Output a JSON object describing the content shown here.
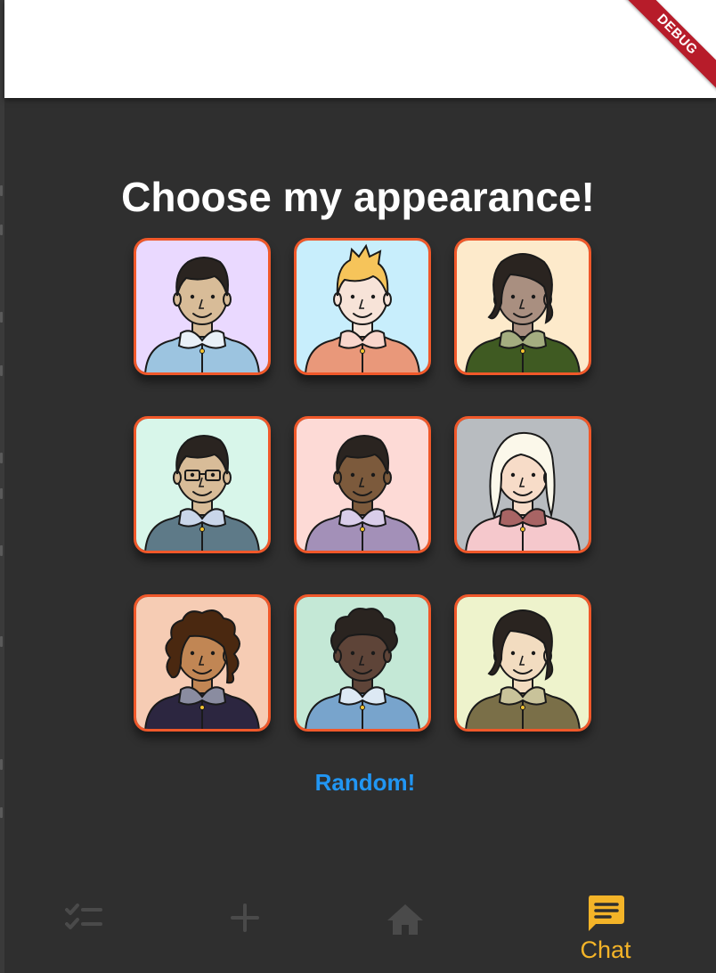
{
  "debug_banner": "DEBUG",
  "title": "Choose my appearance!",
  "random_label": "Random!",
  "avatars": [
    {
      "bg": "#ead9ff",
      "skin": "#d8bc98",
      "hair": "#2a2420",
      "shirt": "#9cc4e0",
      "collar": "#e9f0f7",
      "hair_style": "short"
    },
    {
      "bg": "#c8eefc",
      "skin": "#f7e3d8",
      "hair": "#f6c45a",
      "shirt": "#e9987a",
      "collar": "#f9d6cc",
      "hair_style": "spiky"
    },
    {
      "bg": "#fdeacb",
      "skin": "#a98f80",
      "hair": "#2a2420",
      "shirt": "#3f5a22",
      "collar": "#a4ad80",
      "hair_style": "bob"
    },
    {
      "bg": "#d8f6ea",
      "skin": "#d8bc98",
      "hair": "#2a2420",
      "shirt": "#5e7a88",
      "collar": "#c9d6ea",
      "hair_style": "short",
      "glasses": true
    },
    {
      "bg": "#fddad6",
      "skin": "#7c5a3c",
      "hair": "#2a2420",
      "shirt": "#a390b8",
      "collar": "#d9cdea",
      "hair_style": "short"
    },
    {
      "bg": "#b8bcc0",
      "skin": "#f7dcc8",
      "hair": "#fbf8ea",
      "shirt": "#f5c8cc",
      "collar": "#a86464",
      "hair_style": "long"
    },
    {
      "bg": "#f6ccb4",
      "skin": "#c18654",
      "hair": "#4a2810",
      "shirt": "#2c2640",
      "collar": "#8a8ca0",
      "hair_style": "curly"
    },
    {
      "bg": "#c4e8d6",
      "skin": "#5e4438",
      "hair": "#2a2420",
      "shirt": "#78a4cc",
      "collar": "#dde9f4",
      "hair_style": "afro"
    },
    {
      "bg": "#eef3cc",
      "skin": "#f2dcc0",
      "hair": "#2a2420",
      "shirt": "#7a6f48",
      "collar": "#c9c39a",
      "hair_style": "bob"
    }
  ],
  "nav": {
    "items": [
      {
        "icon": "checklist-icon",
        "label": ""
      },
      {
        "icon": "add-icon",
        "label": ""
      },
      {
        "icon": "home-icon",
        "label": ""
      },
      {
        "icon": "chat-icon",
        "label": "Chat"
      }
    ],
    "active_color": "#f4b428",
    "inactive_color": "#4a4a4a"
  }
}
